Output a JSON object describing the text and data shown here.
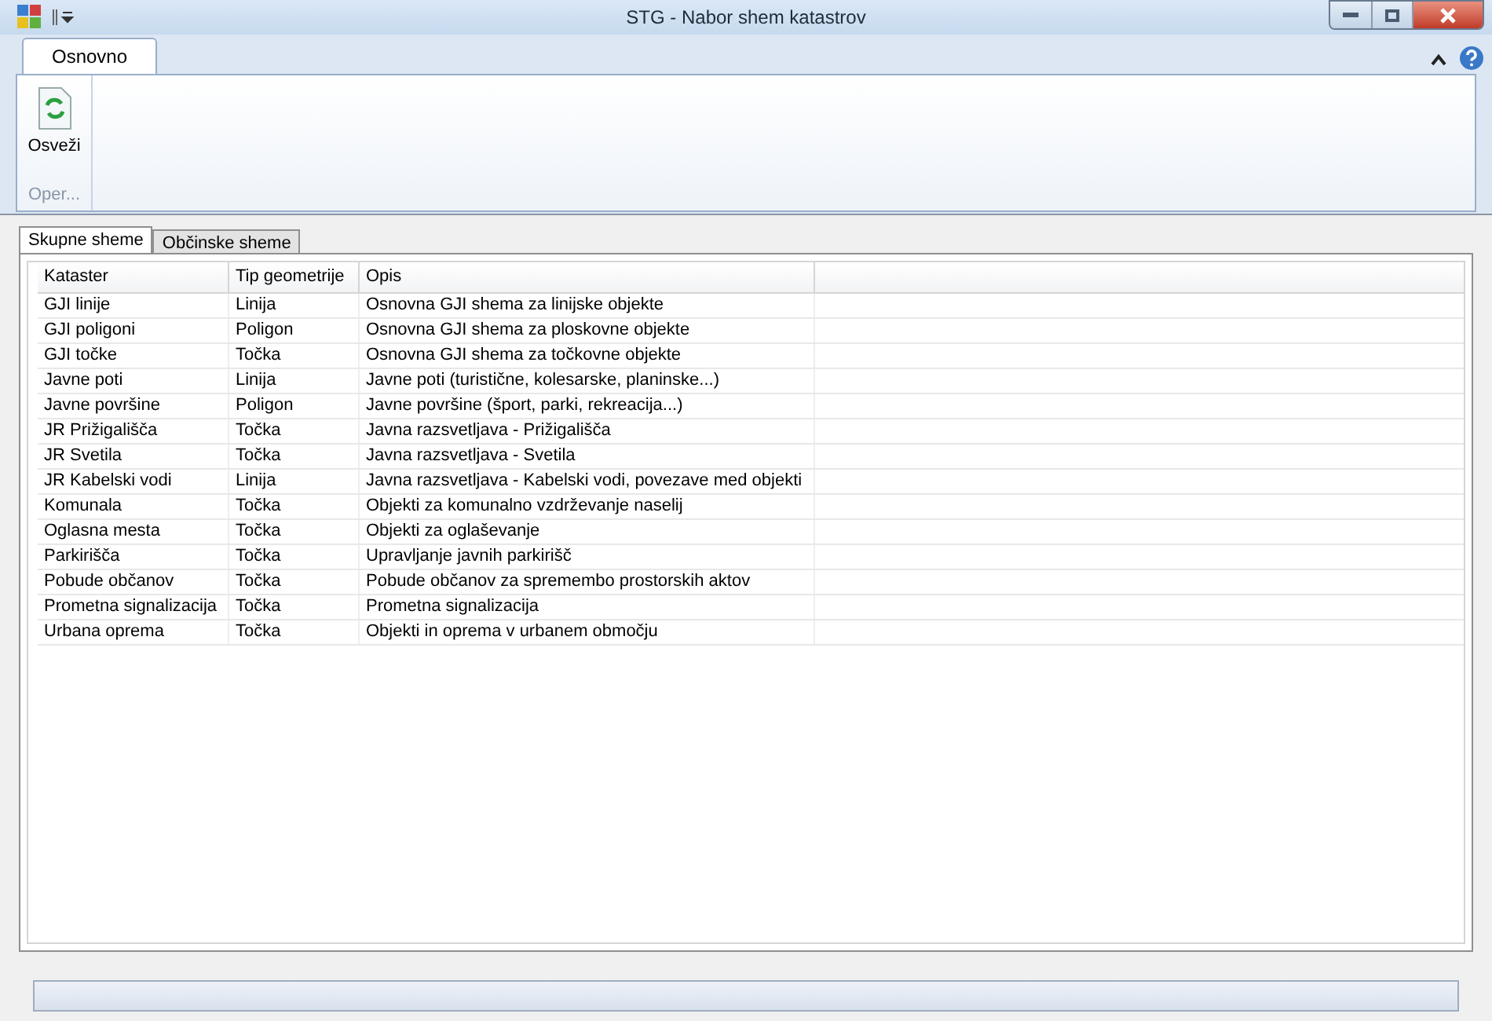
{
  "window": {
    "title": "STG - Nabor shem katastrov"
  },
  "ribbon": {
    "tabs": [
      {
        "label": "Osnovno",
        "selected": true
      }
    ],
    "buttons": [
      {
        "label": "Osveži"
      }
    ],
    "group_label": "Oper..."
  },
  "tabs": [
    {
      "label": "Skupne sheme",
      "selected": true
    },
    {
      "label": "Občinske sheme",
      "selected": false
    }
  ],
  "table": {
    "columns": [
      "Kataster",
      "Tip geometrije",
      "Opis"
    ],
    "rows": [
      [
        "GJI linije",
        "Linija",
        "Osnovna GJI shema za linijske objekte"
      ],
      [
        "GJI poligoni",
        "Poligon",
        "Osnovna GJI shema za ploskovne objekte"
      ],
      [
        "GJI točke",
        "Točka",
        "Osnovna GJI shema za točkovne objekte"
      ],
      [
        "Javne poti",
        "Linija",
        "Javne poti (turistične, kolesarske, planinske...)"
      ],
      [
        "Javne površine",
        "Poligon",
        "Javne površine (šport, parki, rekreacija...)"
      ],
      [
        "JR Prižigališča",
        "Točka",
        "Javna razsvetljava - Prižigališča"
      ],
      [
        "JR Svetila",
        "Točka",
        "Javna razsvetljava - Svetila"
      ],
      [
        "JR Kabelski vodi",
        "Linija",
        "Javna razsvetljava - Kabelski vodi, povezave med objekti"
      ],
      [
        "Komunala",
        "Točka",
        "Objekti za komunalno vzdrževanje naselij"
      ],
      [
        "Oglasna mesta",
        "Točka",
        "Objekti za oglaševanje"
      ],
      [
        "Parkirišča",
        "Točka",
        "Upravljanje javnih parkirišč"
      ],
      [
        "Pobude občanov",
        "Točka",
        "Pobude občanov za spremembo prostorskih aktov"
      ],
      [
        "Prometna signalizacija",
        "Točka",
        "Prometna signalizacija"
      ],
      [
        "Urbana oprema",
        "Točka",
        "Objekti in oprema v urbanem območju"
      ]
    ]
  }
}
